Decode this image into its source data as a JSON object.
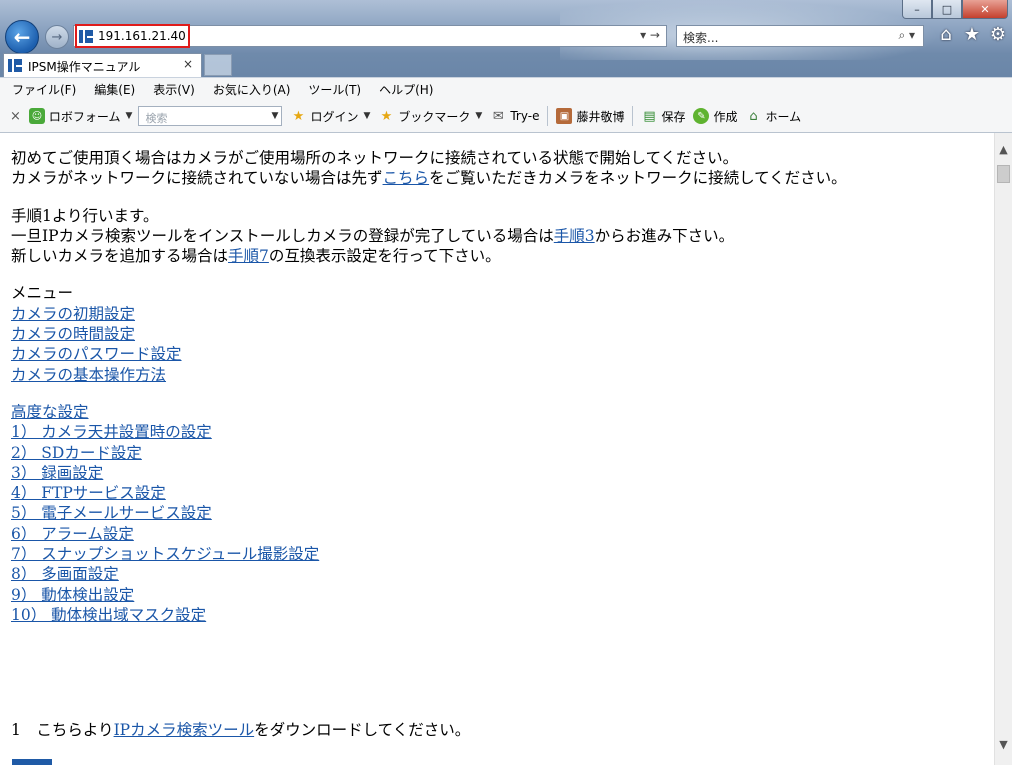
{
  "window": {
    "minimize": "–",
    "maximize": "□",
    "close": "✕"
  },
  "nav": {
    "back": "←",
    "forward": "→"
  },
  "address": {
    "url": "191.161.21.40",
    "controls": "▾ →"
  },
  "search": {
    "placeholder": "検索...",
    "controls": "⌕ ▾"
  },
  "right_icons": {
    "home": "⌂",
    "favorites": "★",
    "settings": "⚙"
  },
  "tab": {
    "title": "IPSM操作マニュアル",
    "close": "×"
  },
  "menu": [
    "ファイル(F)",
    "編集(E)",
    "表示(V)",
    "お気に入り(A)",
    "ツール(T)",
    "ヘルプ(H)"
  ],
  "toolbar": {
    "close": "×",
    "robo_form": "ロボフォーム",
    "search_placeholder": "検索",
    "login": "ログイン",
    "bookmark": "ブックマーク",
    "try_e": "Try-e",
    "user": "藤井敬博",
    "save": "保存",
    "create": "作成",
    "home": "ホーム"
  },
  "content": {
    "intro1": "初めてご使用頂く場合はカメラがご使用場所のネットワークに接続されている状態で開始してください。",
    "intro2_before": "カメラがネットワークに接続されていない場合は先ず",
    "intro2_link": "こちら",
    "intro2_after": "をご覧いただきカメラをネットワークに接続してください。",
    "step_intro": "手順1より行います。",
    "step_line2_before": "一旦IPカメラ検索ツールをインストールしカメラの登録が完了している場合は",
    "step_line2_link": "手順3",
    "step_line2_after": "からお進み下さい。",
    "step_line3_before": "新しいカメラを追加する場合は",
    "step_line3_link": "手順7",
    "step_line3_after": "の互換表示設定を行って下さい。",
    "menu_label": "メニュー",
    "menu_links": [
      "カメラの初期設定",
      "カメラの時間設定",
      "カメラのパスワード設定",
      "カメラの基本操作方法"
    ],
    "advanced_label": "高度な設定",
    "advanced_links": [
      "1） カメラ天井設置時の設定",
      "2） SDカード設定",
      "3） 録画設定",
      "4） FTPサービス設定",
      "5） 電子メールサービス設定",
      "6） アラーム設定",
      "7） スナップショットスケジュール撮影設定",
      "8） 多画面設定",
      "9） 動体検出設定",
      "10） 動体検出域マスク設定"
    ],
    "bottom_before": "1　こちらより",
    "bottom_link": "IPカメラ検索ツール",
    "bottom_after": "をダウンロードしてください。"
  },
  "scrollbar": {
    "up": "▲",
    "down": "▼"
  }
}
